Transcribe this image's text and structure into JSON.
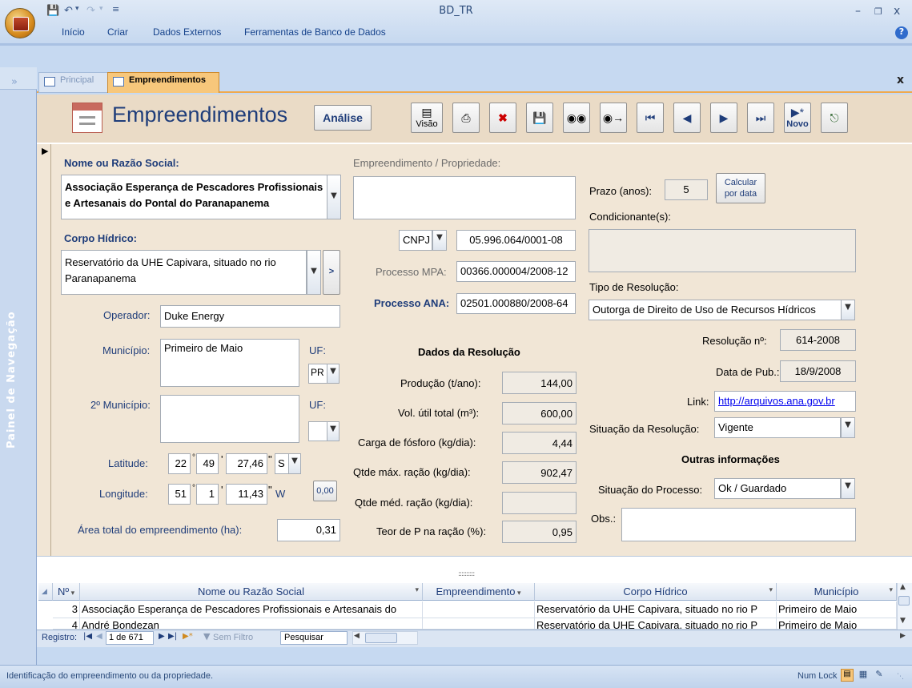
{
  "window": {
    "title": "BD_TR"
  },
  "ribbon": {
    "tabs": [
      "Início",
      "Criar",
      "Dados Externos",
      "Ferramentas de Banco de Dados"
    ]
  },
  "nav_pane": {
    "label": "Painel de Navegação"
  },
  "doc_tabs": [
    {
      "label": "Principal"
    },
    {
      "label": "Empreendimentos"
    }
  ],
  "header": {
    "title": "Empreendimentos",
    "analise_label": "Análise",
    "visao_label": "Visão",
    "novo_label": "Novo"
  },
  "form": {
    "nome_label": "Nome ou Razão Social:",
    "nome_value": "Associação Esperança de Pescadores Profissionais e Artesanais do Pontal do Paranapanema",
    "corpo_label": "Corpo Hídrico:",
    "corpo_value": "Reservatório da UHE Capivara, situado no rio Paranapanema",
    "operador_label": "Operador:",
    "operador_value": "Duke Energy",
    "municipio_label": "Município:",
    "municipio_value": "Primeiro de Maio",
    "uf_label": "UF:",
    "uf_value": "PR",
    "municipio2_label": "2º Município:",
    "uf2_label": "UF:",
    "uf2_value": "",
    "latitude_label": "Latitude:",
    "lat_deg": "22",
    "lat_min": "49",
    "lat_sec": "27,46",
    "lat_hem": "S",
    "longitude_label": "Longitude:",
    "lon_deg": "51",
    "lon_min": "1",
    "lon_sec": "11,43",
    "lon_hem": "W",
    "zero_button": "0,00",
    "area_label": "Área total do empreendimento (ha):",
    "area_value": "0,31",
    "empreend_label": "Empreendimento / Propriedade:",
    "empreend_value": "",
    "doc_type": "CNPJ",
    "doc_value": "05.996.064/0001-08",
    "processo_mpa_label": "Processo MPA:",
    "processo_mpa_value": "00366.000004/2008-12",
    "processo_ana_label": "Processo ANA:",
    "processo_ana_value": "02501.000880/2008-64",
    "dados_title": "Dados da Resolução",
    "producao_label": "Produção (t/ano):",
    "producao_value": "144,00",
    "vol_label": "Vol. útil total (m³):",
    "vol_value": "600,00",
    "fosforo_label": "Carga de fósforo (kg/dia):",
    "fosforo_value": "4,44",
    "racao_max_label": "Qtde máx. ração (kg/dia):",
    "racao_max_value": "902,47",
    "racao_med_label": "Qtde méd. ração (kg/dia):",
    "racao_med_value": "",
    "teor_label": "Teor de P na ração (%):",
    "teor_value": "0,95",
    "prazo_label": "Prazo (anos):",
    "prazo_value": "5",
    "calcular_label_1": "Calcular",
    "calcular_label_2": "por data",
    "condicionantes_label": "Condicionante(s):",
    "condicionantes_value": "",
    "tipo_label": "Tipo de Resolução:",
    "tipo_value": "Outorga de Direito de Uso de Recursos Hídricos",
    "resolucao_label": "Resolução nº:",
    "resolucao_value": "614-2008",
    "data_pub_label": "Data de Pub.:",
    "data_pub_value": "18/9/2008",
    "link_label": "Link:",
    "link_value": "http://arquivos.ana.gov.br",
    "situacao_res_label": "Situação da Resolução:",
    "situacao_res_value": "Vigente",
    "outras_title": "Outras informações",
    "situacao_proc_label": "Situação do Processo:",
    "situacao_proc_value": "Ok / Guardado",
    "obs_label": "Obs.:",
    "obs_value": ""
  },
  "datasheet": {
    "columns": [
      "Nº",
      "Nome ou Razão Social",
      "Empreendimento",
      "Corpo Hídrico",
      "Município"
    ],
    "rows": [
      {
        "n": "3",
        "nome": "Associação Esperança de Pescadores Profissionais e Artesanais do",
        "empreend": "",
        "corpo": "Reservatório da UHE Capivara, situado no rio P",
        "municipio": "Primeiro de Maio"
      },
      {
        "n": "4",
        "nome": "André Bondezan",
        "empreend": "",
        "corpo": "Reservatório da UHE Capivara, situado no rio P",
        "municipio": "Primeiro de Maio"
      }
    ],
    "nav": {
      "registro_label": "Registro:",
      "position": "1 de 671",
      "filter_label": "Sem Filtro",
      "search_label": "Pesquisar"
    }
  },
  "statusbar": {
    "message": "Identificação do empreendimento ou da propriedade.",
    "numlock": "Num Lock"
  }
}
